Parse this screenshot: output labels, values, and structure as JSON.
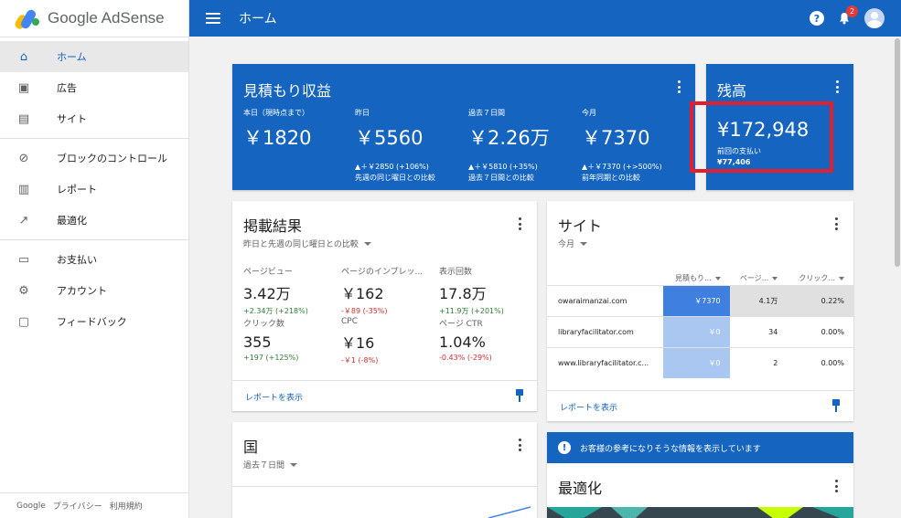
{
  "app": {
    "brand": "Google AdSense"
  },
  "topbar": {
    "title": "ホーム",
    "notification_count": "2"
  },
  "sidebar": {
    "groups": [
      [
        {
          "label": "ホーム",
          "icon": "home-icon"
        },
        {
          "label": "広告",
          "icon": "ads-icon"
        },
        {
          "label": "サイト",
          "icon": "sites-icon"
        }
      ],
      [
        {
          "label": "ブロックのコントロール",
          "icon": "block-icon"
        },
        {
          "label": "レポート",
          "icon": "reports-icon"
        },
        {
          "label": "最適化",
          "icon": "trending-icon"
        }
      ],
      [
        {
          "label": "お支払い",
          "icon": "payments-icon"
        },
        {
          "label": "アカウント",
          "icon": "gear-icon"
        },
        {
          "label": "フィードバック",
          "icon": "feedback-icon"
        }
      ]
    ],
    "footer": {
      "google": "Google",
      "privacy": "プライバシー",
      "terms": "利用規約"
    }
  },
  "estimated": {
    "title": "見積もり収益",
    "cols": [
      {
        "label": "本日（現時点まで）",
        "value": "￥1820",
        "change": "",
        "compare": ""
      },
      {
        "label": "昨日",
        "value": "￥5560",
        "change": "▲＋￥2850 (+106%)",
        "compare": "先週の同じ曜日との比較"
      },
      {
        "label": "過去７日間",
        "value": "￥2.26万",
        "change": "▲＋￥5810 (+35%)",
        "compare": "過去７日間との比較"
      },
      {
        "label": "今月",
        "value": "￥7370",
        "change": "▲＋￥7370 (+>500%)",
        "compare": "前年同期との比較"
      }
    ]
  },
  "balance": {
    "title": "残高",
    "value": "¥172,948",
    "last_payment_label": "前回の支払い",
    "last_payment_value": "¥77,406"
  },
  "performance": {
    "title": "掲載結果",
    "filter": "昨日と先週の同じ曜日との比較",
    "metrics": [
      {
        "label": "ページビュー",
        "value": "3.42万",
        "change": "+2.34万 (+218%)",
        "trend": "pos"
      },
      {
        "label": "ページのインプレッ...",
        "value": "￥162",
        "change": "-￥89 (-35%)",
        "trend": "neg"
      },
      {
        "label": "表示回数",
        "value": "17.8万",
        "change": "+11.9万 (+201%)",
        "trend": "pos"
      },
      {
        "label": "クリック数",
        "value": "355",
        "change": "+197 (+125%)",
        "trend": "pos"
      },
      {
        "label": "CPC",
        "value": "￥16",
        "change": "-￥1 (-8%)",
        "trend": "neg"
      },
      {
        "label": "ページ CTR",
        "value": "1.04%",
        "change": "-0.43% (-29%)",
        "trend": "neg"
      }
    ],
    "footer_link": "レポートを表示"
  },
  "sites": {
    "title": "サイト",
    "filter": "今月",
    "headers": [
      "見積もり...",
      "ページ...",
      "クリック..."
    ],
    "rows": [
      {
        "name": "owaraimanzai.com",
        "earnings": "￥7370",
        "pageviews": "4.1万",
        "ctr": "0.22%"
      },
      {
        "name": "libraryfacilitator.com",
        "earnings": "￥0",
        "pageviews": "34",
        "ctr": "0.00%"
      },
      {
        "name": "www.libraryfacilitator.c...",
        "earnings": "￥0",
        "pageviews": "2",
        "ctr": "0.00%"
      }
    ],
    "colors": {
      "strong": "#3f7fe0",
      "light": "#aac7f2",
      "grey_strong": "#e0e0e0",
      "grey_light": "#f1f1f1"
    },
    "footer_link": "レポートを表示"
  },
  "country": {
    "title": "国",
    "filter": "過去７日間"
  },
  "info": {
    "banner": "お客様の参考になりそうな情報を表示しています",
    "opt_title": "最適化"
  }
}
